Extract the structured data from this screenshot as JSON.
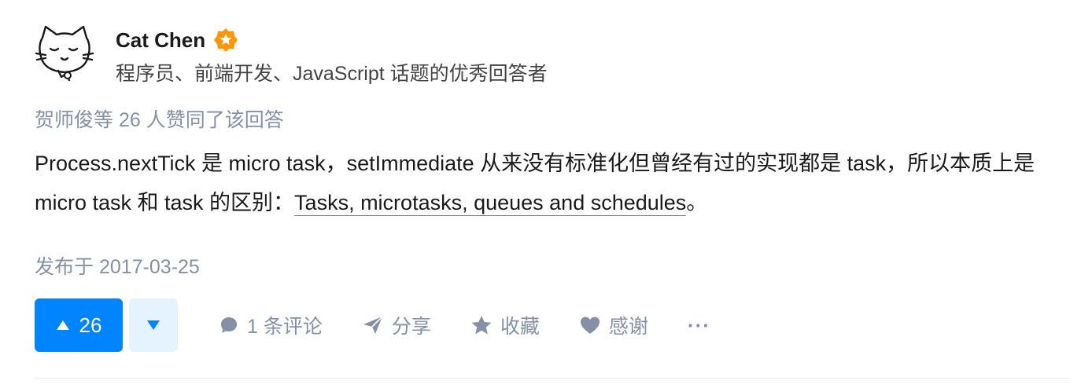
{
  "author": {
    "name": "Cat Chen",
    "headline": "程序员、前端开发、JavaScript 话题的优秀回答者",
    "avatar_icon": "cat-face-icon",
    "badge_icon": "excellent-answerer-badge-icon",
    "badge_color": "#ff9607"
  },
  "voters_text": "贺师俊等 26 人赞同了该回答",
  "content": {
    "text_before_link": "Process.nextTick 是 micro task，setImmediate 从来没有标准化但曾经有过的实现都是 task，所以本质上是 micro task 和 task 的区别：",
    "link_text": "Tasks, microtasks, queues and schedules",
    "text_after_link": "。"
  },
  "publish_time": "发布于 2017-03-25",
  "actions": {
    "vote_up_count": "26",
    "comment_label": "1 条评论",
    "share_label": "分享",
    "favorite_label": "收藏",
    "thanks_label": "感谢",
    "more_label": "···"
  },
  "colors": {
    "primary": "#0084ff",
    "vote_down_bg": "#e5f2ff",
    "meta_gray": "#8590a6"
  }
}
